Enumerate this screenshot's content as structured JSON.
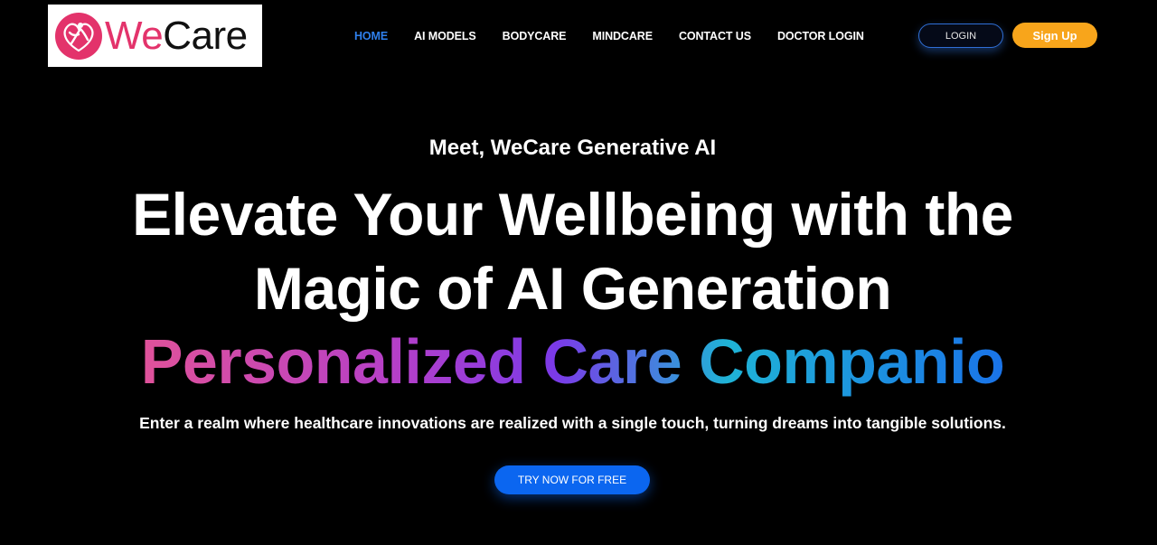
{
  "brand": {
    "name_part1": "We",
    "name_part2": "Care",
    "primary_color": "#e3336b"
  },
  "nav": {
    "items": [
      {
        "label": "HOME",
        "active": true
      },
      {
        "label": "AI MODELS",
        "active": false
      },
      {
        "label": "BODYCARE",
        "active": false
      },
      {
        "label": "MINDCARE",
        "active": false
      },
      {
        "label": "CONTACT US",
        "active": false
      },
      {
        "label": "DOCTOR LOGIN",
        "active": false
      }
    ],
    "active_color": "#2f80ed"
  },
  "auth": {
    "login_label": "LOGIN",
    "signup_label": "Sign Up",
    "signup_color": "#f8a51b"
  },
  "hero": {
    "eyebrow": "Meet, WeCare Generative AI",
    "title_line1": "Elevate Your Wellbeing with the",
    "title_line2": "Magic of AI Generation",
    "gradient_text": "Personalized Care Companio",
    "subtitle": "Enter a realm where healthcare innovations are realized with a single touch, turning dreams into tangible solutions.",
    "cta_label": "TRY NOW FOR FREE",
    "cta_color": "#0b66f0"
  }
}
